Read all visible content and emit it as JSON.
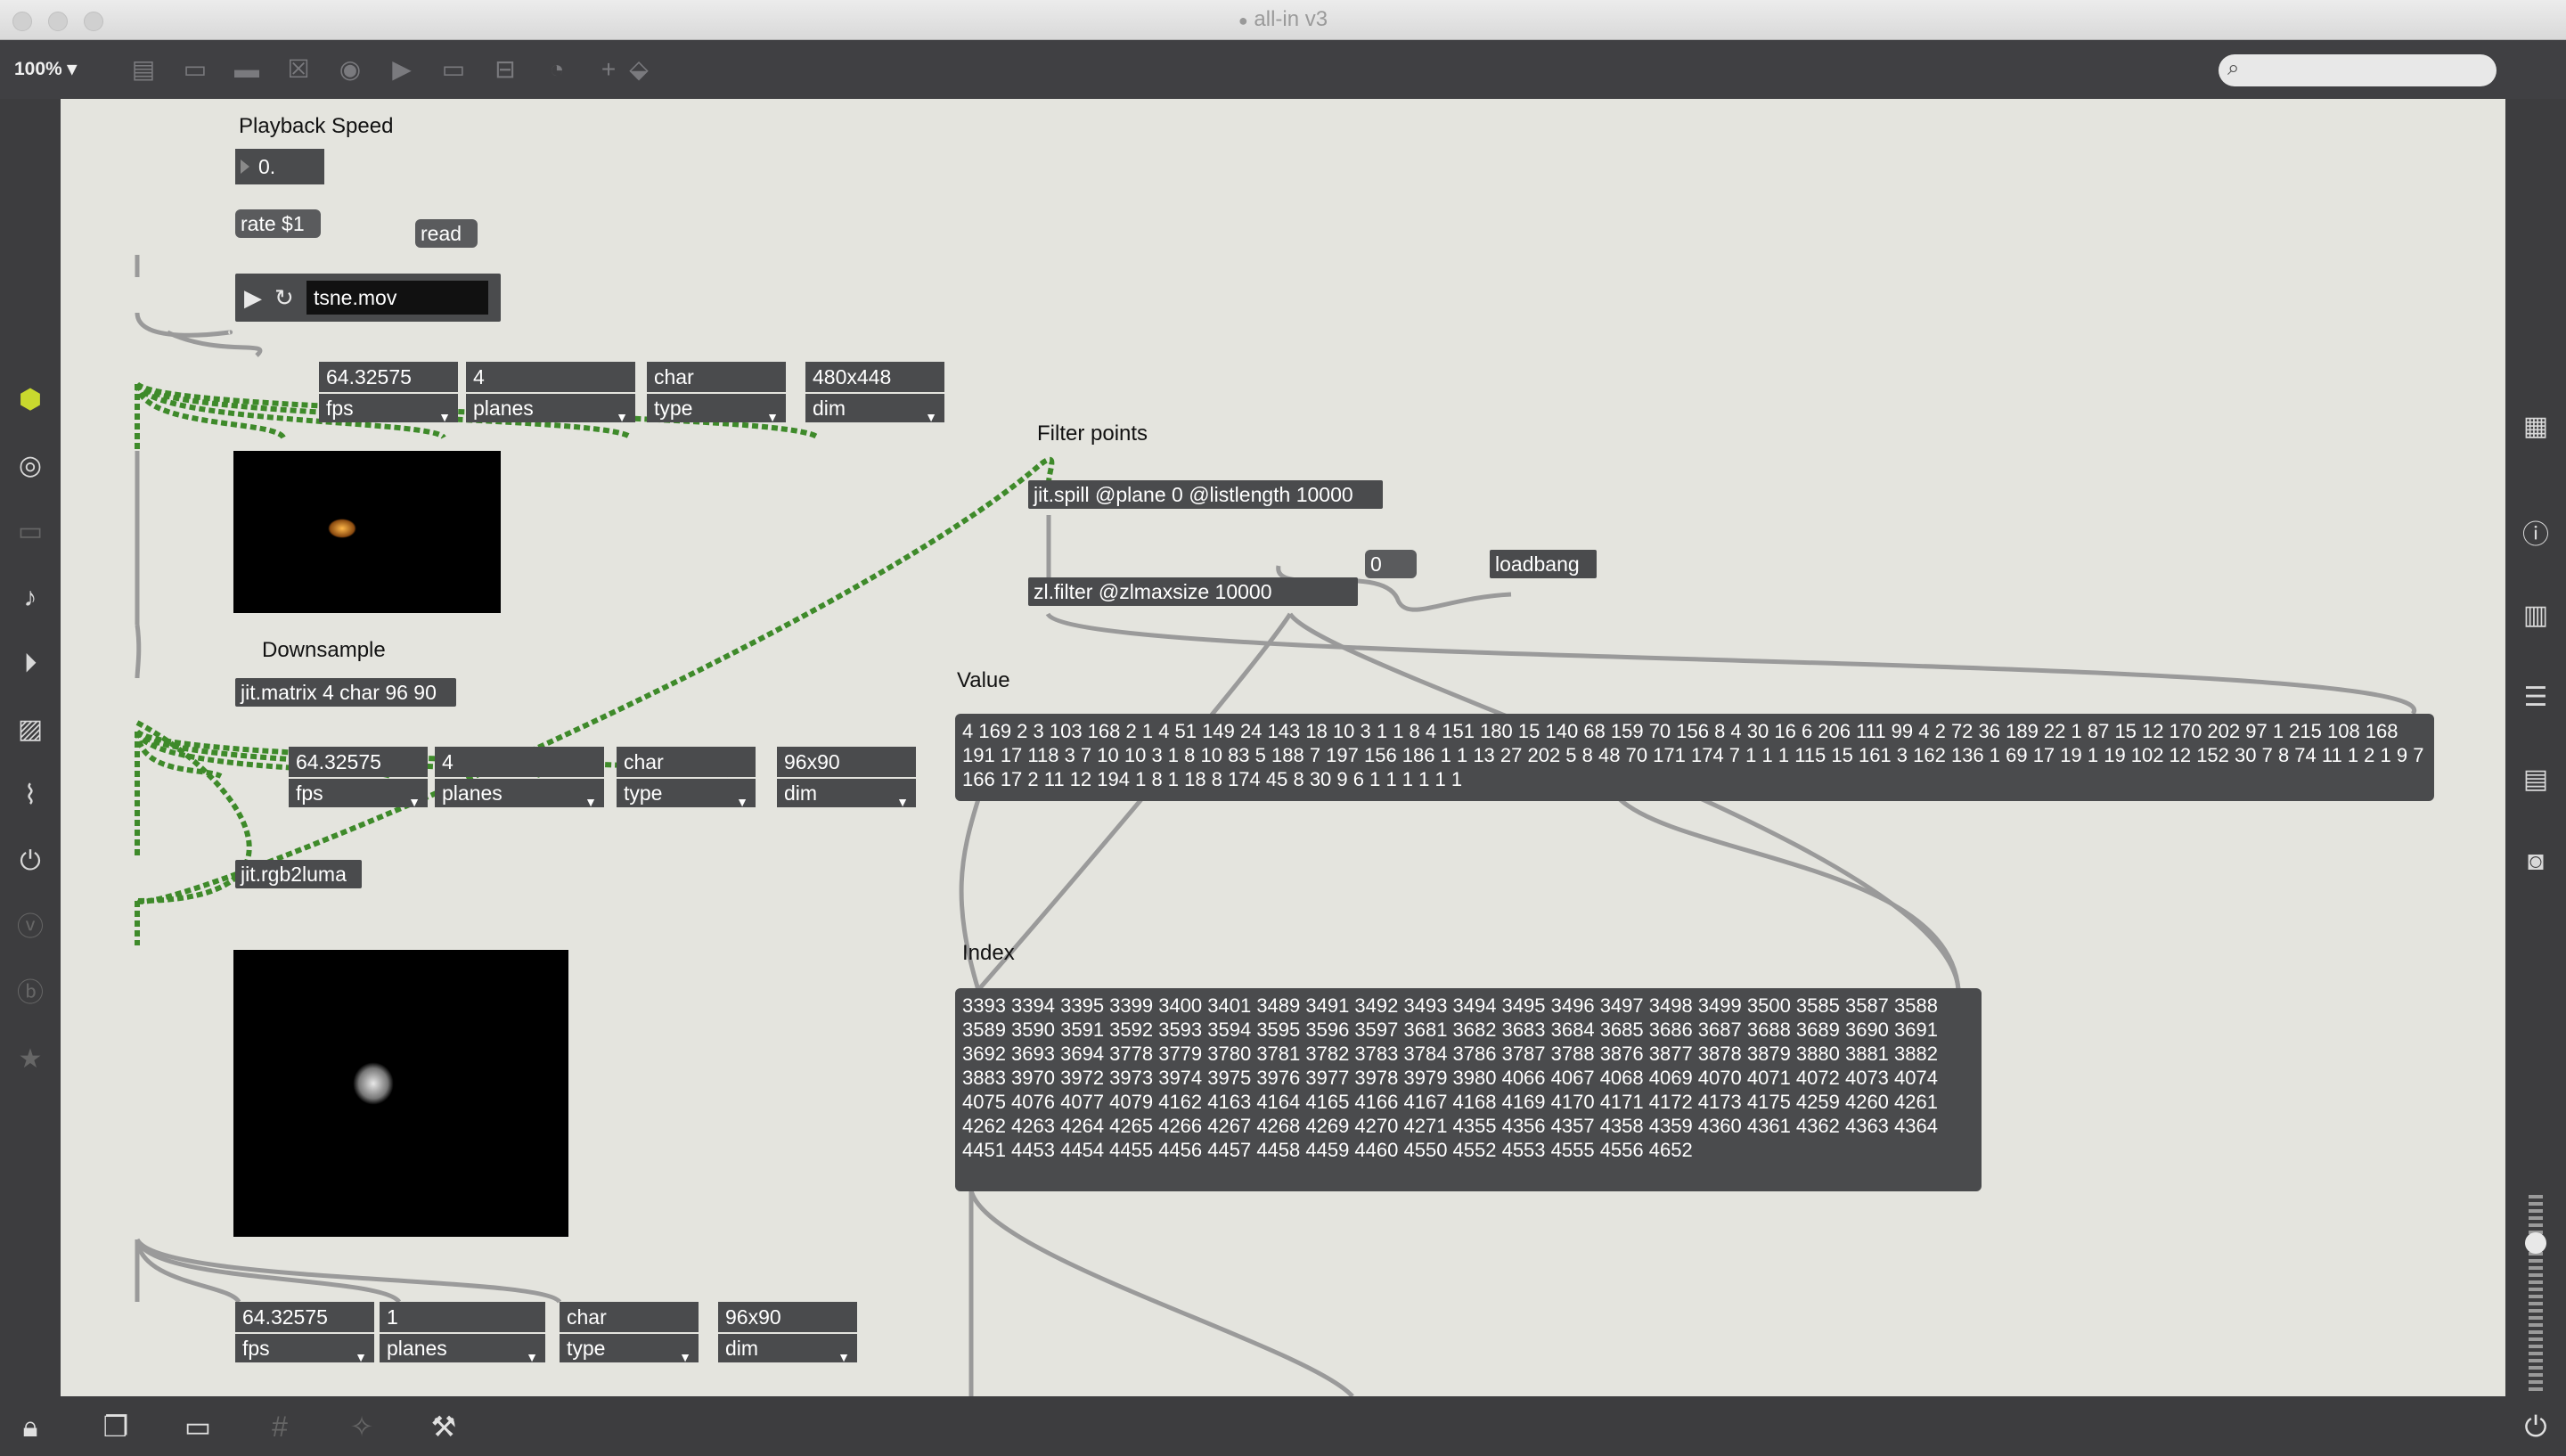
{
  "window": {
    "title": "all-in v3",
    "title_icon": "max-patch-icon"
  },
  "toolbar": {
    "zoom": "100%",
    "icons": [
      "presentation-icon",
      "patching-icon",
      "comment-icon",
      "toggle-icon",
      "button-icon",
      "number-icon",
      "message-icon",
      "slider-icon",
      "dial-icon",
      "add-object-icon",
      "paint-icon"
    ],
    "search_placeholder": ""
  },
  "left_sidebar": {
    "icons": [
      "cube-icon",
      "target-icon",
      "device-icon",
      "note-icon",
      "media-icon",
      "image-icon",
      "paperclip-icon",
      "plug-icon",
      "vimeo-icon",
      "bpatcher-icon",
      "star-icon"
    ]
  },
  "right_sidebar": {
    "icons": [
      "grid-icon",
      "info-icon",
      "book-icon",
      "list-icon",
      "reference-icon",
      "camera-icon"
    ]
  },
  "bottom_bar": {
    "icons": [
      "lock-icon",
      "windows-icon",
      "presentation-icon",
      "grid-icon",
      "wand-icon",
      "wrench-icon",
      "power-icon"
    ]
  },
  "patch": {
    "labels": {
      "playback_speed": "Playback Speed",
      "downsample": "Downsample",
      "filter_points": "Filter points",
      "value": "Value",
      "index": "Index"
    },
    "speed_number": "0.",
    "rate_msg": "rate $1",
    "read_msg": "read",
    "movie_file": "tsne.mov",
    "attrs1": [
      {
        "value": "64.32575",
        "name": "fps"
      },
      {
        "value": "4",
        "name": "planes"
      },
      {
        "value": "char",
        "name": "type"
      },
      {
        "value": "480x448",
        "name": "dim"
      }
    ],
    "matrix_obj": "jit.matrix 4 char 96 90",
    "attrs2": [
      {
        "value": "64.32575",
        "name": "fps"
      },
      {
        "value": "4",
        "name": "planes"
      },
      {
        "value": "char",
        "name": "type"
      },
      {
        "value": "96x90",
        "name": "dim"
      }
    ],
    "rgb2luma_obj": "jit.rgb2luma",
    "attrs3": [
      {
        "value": "64.32575",
        "name": "fps"
      },
      {
        "value": "1",
        "name": "planes"
      },
      {
        "value": "char",
        "name": "type"
      },
      {
        "value": "96x90",
        "name": "dim"
      }
    ],
    "spill_obj": "jit.spill @plane 0 @listlength 10000",
    "filter_obj": "zl.filter @zlmaxsize 10000",
    "zero_msg": "0",
    "loadbang_obj": "loadbang",
    "value_msg": "4 169 2 3 103 168 2 1 4 51 149 24 143 18 10 3 1 1 8 4 151 180 15 140 68 159 70 156 8 4 30 16 6 206 111 99 4 2 72 36 189 22 1 87 15 12 170 202 97 1 215 108 168 191 17 118 3 7 10 10 3 1 8 10 83 5 188 7 197 156 186 1 1 13 27 202 5 8 48 70 171 174 7 1 1 1 115 15 161 3 162 136 1 69 17 19 1 19 102 12 152 30 7 8 74 11 1 2 1 9 7 166 17 2 11 12 194 1 8 1 18 8 174 45 8 30 9 6 1 1 1 1 1 1",
    "index_msg": "3393 3394 3395 3399 3400 3401 3489 3491 3492 3493 3494 3495 3496 3497 3498 3499 3500 3585 3587 3588 3589 3590 3591 3592 3593 3594 3595 3596 3597 3681 3682 3683 3684 3685 3686 3687 3688 3689 3690 3691 3692 3693 3694 3778 3779 3780 3781 3782 3783 3784 3786 3787 3788 3876 3877 3878 3879 3880 3881 3882 3883 3970 3972 3973 3974 3975 3976 3977 3978 3979 3980 4066 4067 4068 4069 4070 4071 4072 4073 4074 4075 4076 4077 4079 4162 4163 4164 4165 4166 4167 4168 4169 4170 4171 4172 4173 4175 4259 4260 4261 4262 4263 4264 4265 4266 4267 4268 4269 4270 4271 4355 4356 4357 4358 4359 4360 4361 4362 4363 4364 4451 4453 4454 4455 4456 4457 4458 4459 4460 4550 4552 4553 4555 4556 4652"
  },
  "colors": {
    "canvas": "#e4e4de",
    "object": "#4a4b4d",
    "jitter_cord": "#3e8a2a",
    "cord": "#9a9a9a",
    "chrome": "#3d3d3f"
  }
}
